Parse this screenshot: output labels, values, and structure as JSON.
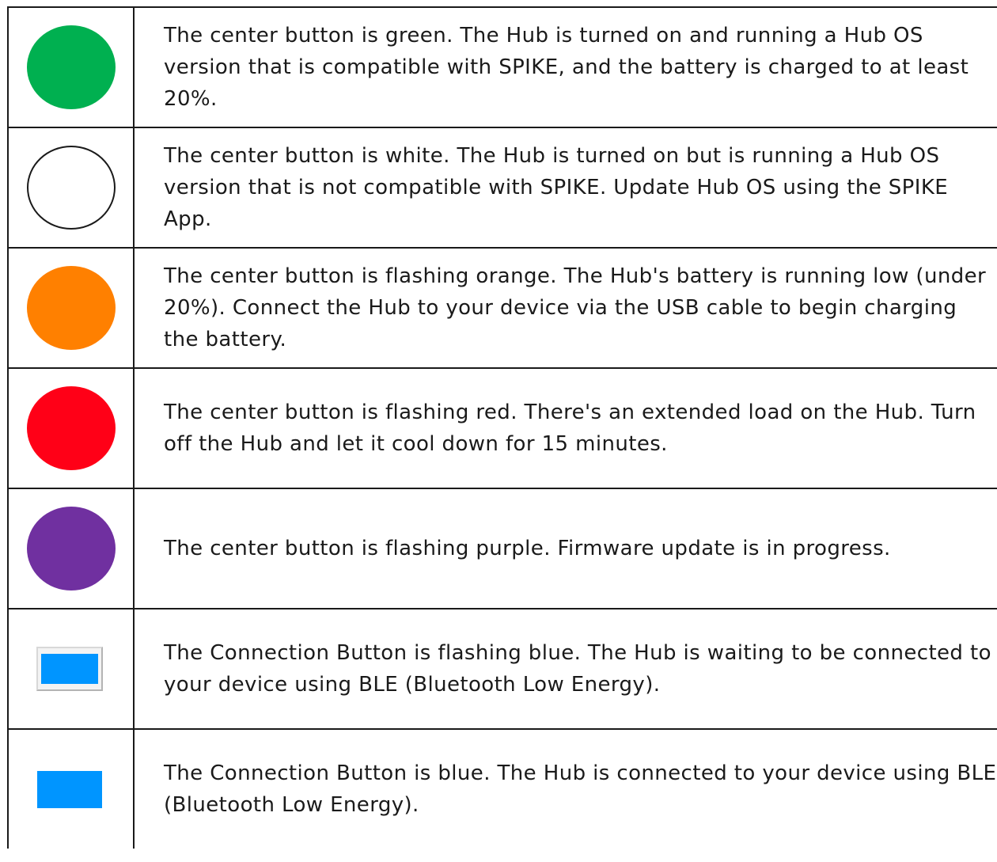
{
  "rows": [
    {
      "indicator": "green-circle-icon",
      "color": "#00b050",
      "text": "The center button is green. The Hub is turned on and running a Hub OS version that is compatible with SPIKE, and the battery is charged to at least 20%."
    },
    {
      "indicator": "white-circle-icon",
      "color": "#ffffff",
      "text": "The center button is white. The Hub is turned on but is running a Hub OS version that is not compatible with SPIKE. Update Hub OS using the SPIKE App."
    },
    {
      "indicator": "orange-circle-icon",
      "color": "#ff8000",
      "text": "The center button is flashing orange. The Hub's battery is running low (under 20%). Connect the Hub to your device via the USB cable to begin charging the battery."
    },
    {
      "indicator": "red-circle-icon",
      "color": "#ff0017",
      "text": "The center button is flashing red. There's an extended load on the Hub. Turn off the Hub and let it cool down for 15 minutes."
    },
    {
      "indicator": "purple-circle-icon",
      "color": "#7030a0",
      "text": "The center button is flashing purple. Firmware update is in progress."
    },
    {
      "indicator": "blue-framed-rectangle-icon",
      "color": "#0095ff",
      "text": "The Connection Button is flashing blue. The Hub is waiting to be connected to your device using BLE (Bluetooth Low Energy)."
    },
    {
      "indicator": "blue-rectangle-icon",
      "color": "#0095ff",
      "text": "The Connection Button is blue. The Hub is connected to your device using BLE (Bluetooth Low Energy)."
    }
  ]
}
